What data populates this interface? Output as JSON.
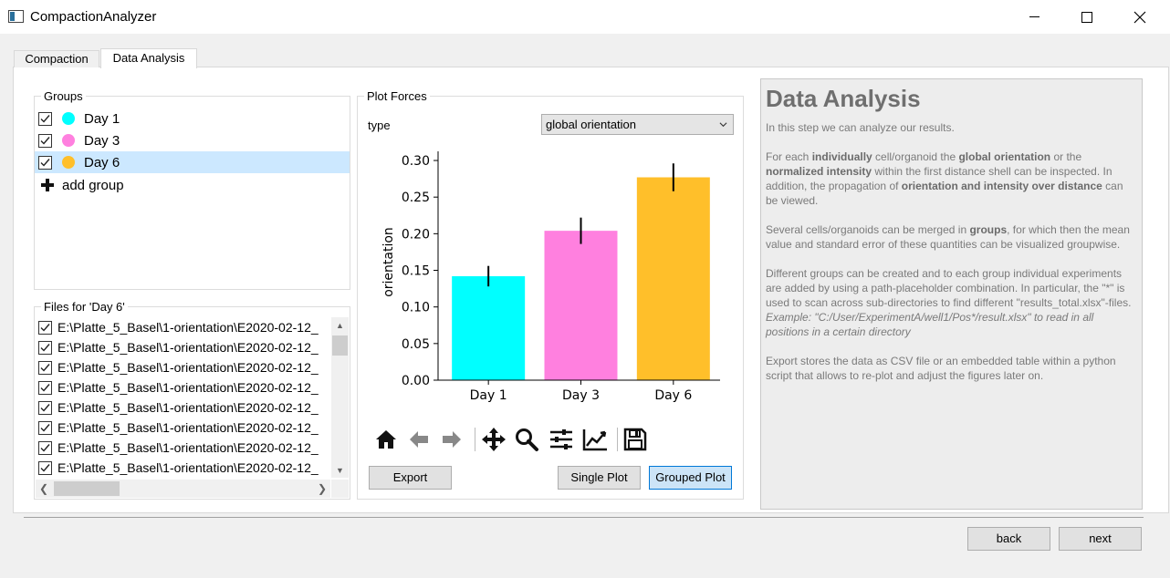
{
  "window": {
    "title": "CompactionAnalyzer"
  },
  "tabs": [
    {
      "label": "Compaction",
      "active": false
    },
    {
      "label": "Data Analysis",
      "active": true
    }
  ],
  "groups": {
    "title": "Groups",
    "items": [
      {
        "label": "Day 1",
        "checked": true,
        "color": "#00ffff",
        "selected": false
      },
      {
        "label": "Day 3",
        "checked": true,
        "color": "#ff80df",
        "selected": false
      },
      {
        "label": "Day 6",
        "checked": true,
        "color": "#ffbf2a",
        "selected": true
      }
    ],
    "add_label": "add group"
  },
  "files": {
    "title": "Files for 'Day 6'",
    "items": [
      "E:\\Platte_5_Basel\\1-orientation\\E2020-02-12_",
      "E:\\Platte_5_Basel\\1-orientation\\E2020-02-12_",
      "E:\\Platte_5_Basel\\1-orientation\\E2020-02-12_",
      "E:\\Platte_5_Basel\\1-orientation\\E2020-02-12_",
      "E:\\Platte_5_Basel\\1-orientation\\E2020-02-12_",
      "E:\\Platte_5_Basel\\1-orientation\\E2020-02-12_",
      "E:\\Platte_5_Basel\\1-orientation\\E2020-02-12_",
      "E:\\Platte_5_Basel\\1-orientation\\E2020-02-12_"
    ]
  },
  "plot": {
    "title": "Plot Forces",
    "type_label": "type",
    "type_value": "global orientation",
    "toolbar": [
      "home-icon",
      "back-arrow-icon",
      "forward-arrow-icon",
      "pan-icon",
      "zoom-icon",
      "subplots-config-icon",
      "axes-edit-icon",
      "save-icon"
    ],
    "export_label": "Export",
    "single_plot_label": "Single Plot",
    "grouped_plot_label": "Grouped Plot"
  },
  "chart_data": {
    "type": "bar",
    "categories": [
      "Day 1",
      "Day 3",
      "Day 6"
    ],
    "values": [
      0.142,
      0.204,
      0.277
    ],
    "errors": [
      0.014,
      0.018,
      0.019
    ],
    "colors": [
      "#00ffff",
      "#ff80df",
      "#ffbf2a"
    ],
    "ylabel": "orientation",
    "xlabel": "",
    "ylim": [
      0,
      0.31
    ],
    "yticks": [
      "0.00",
      "0.05",
      "0.10",
      "0.15",
      "0.20",
      "0.25",
      "0.30"
    ]
  },
  "help": {
    "heading": "Data Analysis",
    "p1": "In this step we can analyze our results.",
    "p2": [
      {
        "t": "For each ",
        "b": false
      },
      {
        "t": "individually",
        "b": true
      },
      {
        "t": " cell/organoid the ",
        "b": false
      },
      {
        "t": "global orientation",
        "b": true
      },
      {
        "t": " or the ",
        "b": false
      },
      {
        "t": "normalized intensity",
        "b": true
      },
      {
        "t": " within the first distance shell can be inspected. In addition, the propagation of ",
        "b": false
      },
      {
        "t": "orientation and intensity over distance",
        "b": true
      },
      {
        "t": " can be viewed.",
        "b": false
      }
    ],
    "p3": [
      {
        "t": "Several cells/organoids can be merged in ",
        "b": false
      },
      {
        "t": "groups",
        "b": true
      },
      {
        "t": ", for which then the mean value and standard error of these quantities can be visualized groupwise.",
        "b": false
      }
    ],
    "p4": "Different groups can be created and to each group individual experiments are added by using a path-placeholder combination. In particular, the \"*\" is used to scan across sub-directories to find different \"results_total.xlsx\"-files.",
    "p4_example": "Example: \"C:/User/ExperimentA/well1/Pos*/result.xlsx\" to read in all positions in a certain directory",
    "p5": "Export stores the data as CSV file or an embedded table within a python script that allows to re-plot and adjust the figures later on."
  },
  "nav": {
    "back_label": "back",
    "next_label": "next"
  }
}
